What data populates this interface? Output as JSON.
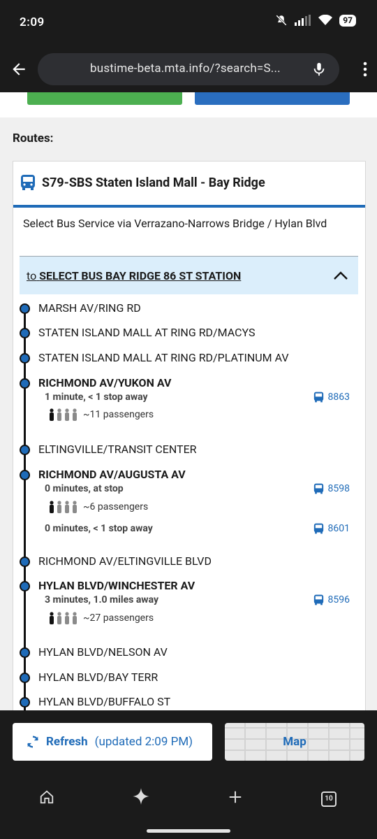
{
  "status": {
    "time": "2:09",
    "battery": "97"
  },
  "browser": {
    "url": "bustime-beta.mta.info/?search=S..."
  },
  "page": {
    "routes_label": "Routes:",
    "route": {
      "title": "S79-SBS Staten Island Mall - Bay Ridge",
      "service": "Select Bus Service via Verrazano-Narrows Bridge / Hylan Blvd",
      "direction_prefix": "to",
      "direction": "SELECT BUS BAY RIDGE 86 ST STATION"
    },
    "stops": [
      {
        "name": "MARSH AV/RING RD"
      },
      {
        "name": "STATEN ISLAND MALL AT RING RD/MACYS"
      },
      {
        "name": "STATEN ISLAND MALL AT RING RD/PLATINUM AV"
      },
      {
        "name": "RICHMOND AV/YUKON AV",
        "arrivals": [
          {
            "eta": "1 minute, < 1 stop away",
            "vehicle": "8863",
            "passengers": "~11 passengers",
            "load_level": 1
          }
        ]
      },
      {
        "name": "ELTINGVILLE/TRANSIT CENTER"
      },
      {
        "name": "RICHMOND AV/AUGUSTA AV",
        "arrivals": [
          {
            "eta": "0 minutes, at stop",
            "vehicle": "8598",
            "passengers": "~6 passengers",
            "load_level": 1
          },
          {
            "eta": "0 minutes, < 1 stop away",
            "vehicle": "8601"
          }
        ]
      },
      {
        "name": "RICHMOND AV/ELTINGVILLE BLVD"
      },
      {
        "name": "HYLAN BLVD/WINCHESTER AV",
        "arrivals": [
          {
            "eta": "3 minutes, 1.0 miles away",
            "vehicle": "8596",
            "passengers": "~27 passengers",
            "load_level": 1
          }
        ]
      },
      {
        "name": "HYLAN BLVD/NELSON AV"
      },
      {
        "name": "HYLAN BLVD/BAY TERR"
      },
      {
        "name": "HYLAN BLVD/BUFFALO ST"
      }
    ]
  },
  "toolbar": {
    "refresh_label": "Refresh",
    "updated": "(updated 2:09 PM)",
    "map_label": "Map"
  },
  "nav": {
    "tab_count": "10"
  },
  "colors": {
    "accent": "#1f6bb8",
    "green": "#4caf50",
    "highlight": "#dbeefb"
  }
}
